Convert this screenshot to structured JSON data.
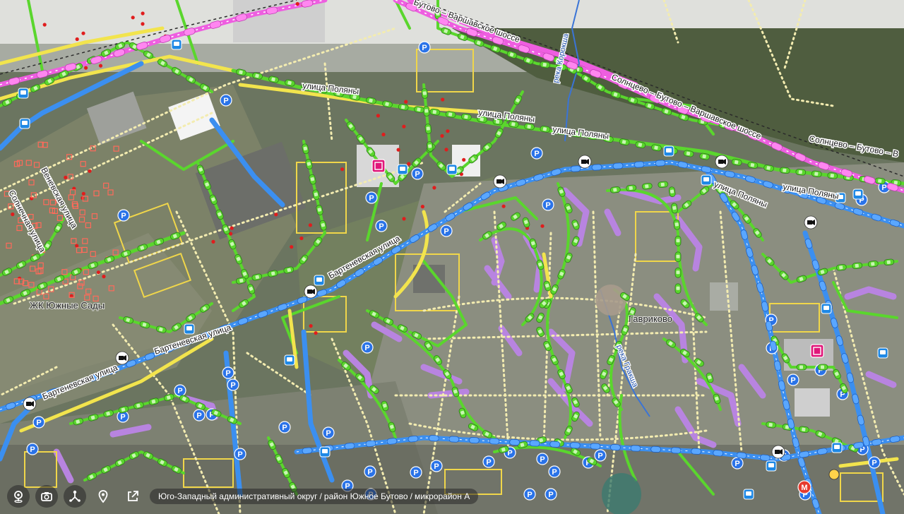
{
  "map": {
    "street_labels": [
      {
        "text": "Бутово – Варшавское шоссе"
      },
      {
        "text": "Солнцево – Бутово – Варшавское шоссе"
      },
      {
        "text": "Солнцево – Бутово – В"
      },
      {
        "text": "улица Поляны"
      },
      {
        "text": "улица Поляны"
      },
      {
        "text": "улица Поляны"
      },
      {
        "text": "улица Поляны"
      },
      {
        "text": "улица Поляны"
      },
      {
        "text": "Бартеневская улица"
      },
      {
        "text": "Бартеневская улица"
      },
      {
        "text": "Бартеневская улица"
      },
      {
        "text": "Веневская улица"
      },
      {
        "text": "Солнечная улица"
      }
    ],
    "water_labels": [
      {
        "text": "река Корокша"
      },
      {
        "text": "река Гракша"
      }
    ],
    "area_labels": [
      {
        "text": "ЖК Южные Сады"
      },
      {
        "text": "Гавриково"
      }
    ],
    "colors": {
      "green_road": "#5ad62d",
      "yellow_road": "#f2e44d",
      "blue_road": "#3b8ff0",
      "pink_road": "#ee5ee0",
      "parking_blue": "#2a73e8",
      "building_purple": "#b884e0",
      "building_yellow": "#f0d64a",
      "bus_stop": "#1e88e5",
      "speed_camera": "#ffffff"
    }
  },
  "toolbar": {
    "buttons": [
      {
        "icon": "location-pin-icon"
      },
      {
        "icon": "camera-icon"
      },
      {
        "icon": "route-icon"
      },
      {
        "icon": "map-pin-icon"
      },
      {
        "icon": "external-link-icon"
      }
    ],
    "breadcrumb": [
      "Юго-Западный административный округ",
      "район Южное Бутово",
      "микрорайон А"
    ],
    "breadcrumb_separator": "/"
  }
}
